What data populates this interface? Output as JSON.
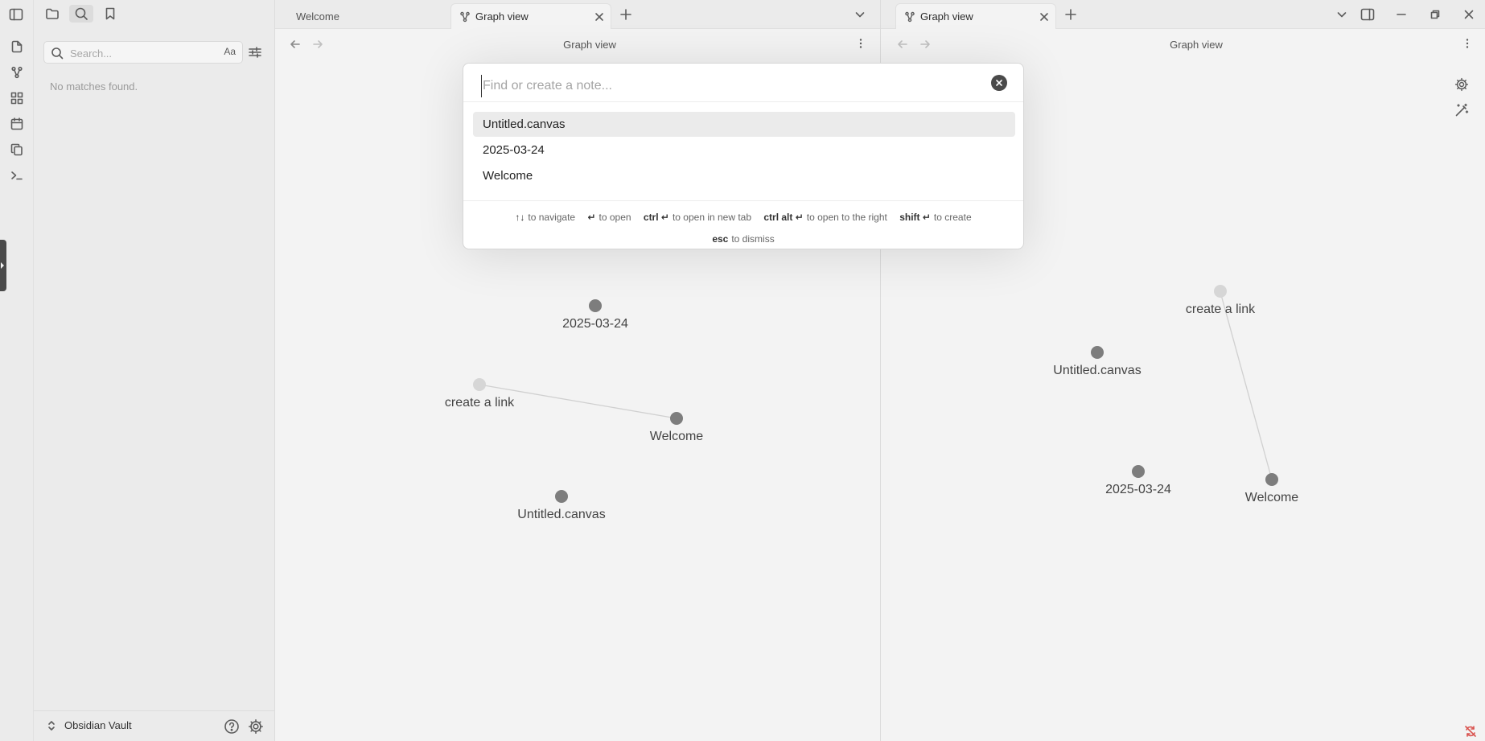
{
  "ribbon": {
    "items": [
      {
        "icon": "file-plus-icon"
      },
      {
        "icon": "graph-icon"
      },
      {
        "icon": "canvas-icon"
      },
      {
        "icon": "calendar-icon"
      },
      {
        "icon": "copy-icon"
      },
      {
        "icon": "terminal-icon"
      }
    ]
  },
  "sidebar": {
    "search": {
      "placeholder": "Search...",
      "match_case_label": "Aa",
      "empty_message": "No matches found."
    },
    "vault_name": "Obsidian Vault"
  },
  "left_pane": {
    "tabs": [
      {
        "label": "Welcome",
        "active": false
      },
      {
        "label": "Graph view",
        "active": true
      }
    ],
    "view_title": "Graph view",
    "nodes": [
      {
        "label": "2025-03-24",
        "resolved": true
      },
      {
        "label": "create a link",
        "resolved": false
      },
      {
        "label": "Welcome",
        "resolved": true
      },
      {
        "label": "Untitled.canvas",
        "resolved": true
      }
    ]
  },
  "right_pane": {
    "tabs": [
      {
        "label": "Graph view",
        "active": true
      }
    ],
    "view_title": "Graph view",
    "nodes": [
      {
        "label": "create a link",
        "resolved": false
      },
      {
        "label": "Untitled.canvas",
        "resolved": true
      },
      {
        "label": "2025-03-24",
        "resolved": true
      },
      {
        "label": "Welcome",
        "resolved": true
      }
    ]
  },
  "quick_switcher": {
    "placeholder": "Find or create a note...",
    "value": "",
    "suggestions": [
      {
        "label": "Untitled.canvas",
        "selected": true
      },
      {
        "label": "2025-03-24",
        "selected": false
      },
      {
        "label": "Welcome",
        "selected": false
      }
    ],
    "instructions": [
      {
        "key": "↑↓",
        "text": "to navigate"
      },
      {
        "key": "↵",
        "text": "to open"
      },
      {
        "key": "ctrl ↵",
        "text": "to open in new tab"
      },
      {
        "key": "ctrl alt ↵",
        "text": "to open to the right"
      },
      {
        "key": "shift ↵",
        "text": "to create"
      },
      {
        "key": "esc",
        "text": "to dismiss"
      }
    ]
  },
  "colors": {
    "background": "#f3f3f3",
    "node": "#7d7d7d",
    "unresolved_node": "#d6d6d6"
  }
}
